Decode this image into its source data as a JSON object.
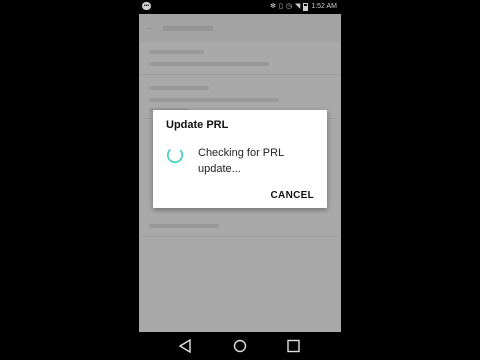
{
  "status_bar": {
    "notification_icon": "message-bubble-icon",
    "icons": [
      "settings-icon",
      "hd-voice-icon",
      "vibrate-icon",
      "alarm-icon",
      "wifi-icon",
      "battery-icon"
    ],
    "time": "1:52 AM"
  },
  "app": {
    "header_icon": "back-arrow-icon"
  },
  "dialog": {
    "title": "Update PRL",
    "message": "Checking for PRL update...",
    "cancel_label": "CANCEL",
    "spinner_color": "#4dd0c4"
  },
  "nav_bar": {
    "buttons": [
      "back-triangle-icon",
      "home-circle-icon",
      "recents-square-icon"
    ]
  }
}
